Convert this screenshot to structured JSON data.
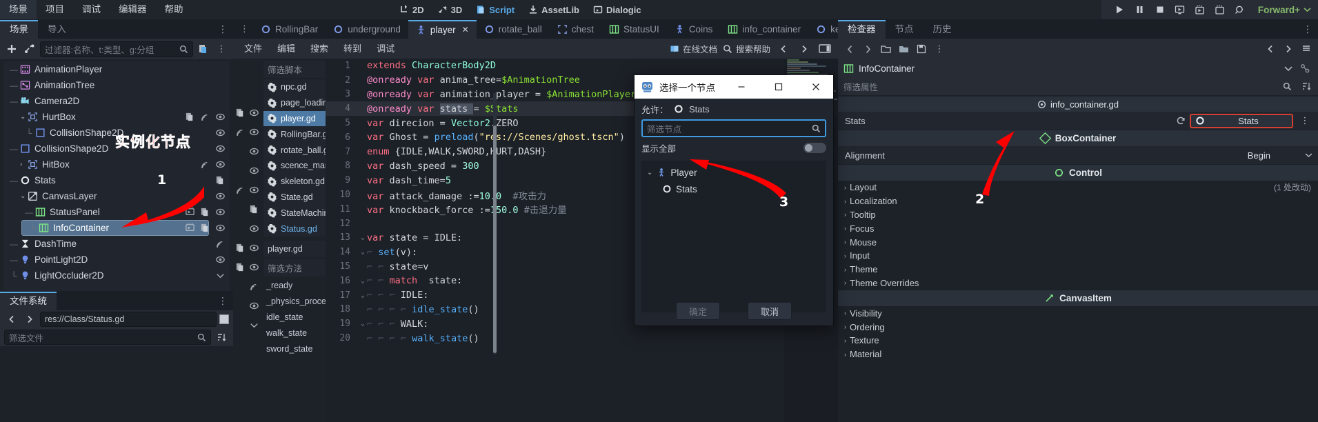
{
  "menu": {
    "items": [
      "场景",
      "项目",
      "调试",
      "编辑器",
      "帮助"
    ]
  },
  "modes": [
    {
      "label": "2D",
      "icon": "2d-icon",
      "active": false
    },
    {
      "label": "3D",
      "icon": "3d-icon",
      "active": false
    },
    {
      "label": "Script",
      "icon": "script-icon",
      "active": true
    },
    {
      "label": "AssetLib",
      "icon": "assetlib-icon",
      "active": false
    },
    {
      "label": "Dialogic",
      "icon": "dialogic-icon",
      "active": false
    }
  ],
  "playbar": {
    "buttons": [
      "play-icon",
      "pause-icon",
      "stop-icon",
      "play-scene-icon",
      "play-custom-icon",
      "movie-writer-icon",
      "remote-debug-icon"
    ],
    "renderer": "Forward+"
  },
  "left_dock": {
    "tabs": [
      {
        "label": "场景",
        "active": true
      },
      {
        "label": "导入",
        "active": false
      }
    ],
    "toolbar": {
      "add_icon": "plus-icon",
      "link_icon": "instance-child-scene-icon",
      "filter_placeholder": "过滤器:名称、t:类型、g:分组",
      "search_icon": "search-icon",
      "script_icon": "attach-script-icon",
      "more_icon": "vertical-dots-icon"
    },
    "tree": [
      {
        "label": "AnimationPlayer",
        "depth": 1,
        "icon": "animationplayer-icon",
        "caret": "",
        "branch": "—",
        "right": [],
        "selected": false
      },
      {
        "label": "AnimationTree",
        "depth": 1,
        "icon": "animationtree-icon",
        "caret": "",
        "branch": "—",
        "right": [],
        "selected": false
      },
      {
        "label": "Camera2D",
        "depth": 1,
        "icon": "camera2d-icon",
        "caret": "",
        "branch": "—",
        "right": [],
        "selected": false
      },
      {
        "label": "HurtBox",
        "depth": 1,
        "icon": "area2d-icon",
        "caret": "⌄",
        "branch": "",
        "right": [
          "script-icon",
          "signal-icon",
          "eye-icon"
        ],
        "selected": false
      },
      {
        "label": "CollisionShape2D",
        "depth": 2,
        "icon": "collisionshape2d-icon",
        "caret": "",
        "branch": "└",
        "right": [
          "eye-icon"
        ],
        "selected": false
      },
      {
        "label": "CollisionShape2D",
        "depth": 1,
        "icon": "collisionshape2d-icon",
        "caret": "",
        "branch": "—",
        "right": [
          "eye-icon"
        ],
        "selected": false
      },
      {
        "label": "HitBox",
        "depth": 1,
        "icon": "area2d-icon",
        "caret": "›",
        "branch": "",
        "right": [
          "signal-icon",
          "eye-icon"
        ],
        "selected": false
      },
      {
        "label": "Stats",
        "depth": 1,
        "icon": "node-icon",
        "caret": "",
        "branch": "—",
        "right": [
          "script-icon"
        ],
        "selected": false
      },
      {
        "label": "CanvasLayer",
        "depth": 1,
        "icon": "canvaslayer-icon",
        "caret": "⌄",
        "branch": "",
        "right": [
          "eye-icon"
        ],
        "selected": false
      },
      {
        "label": "StatusPanel",
        "depth": 2,
        "icon": "container-icon",
        "caret": "",
        "branch": "—",
        "right": [
          "scene-instance-icon",
          "script-icon",
          "eye-icon"
        ],
        "selected": false
      },
      {
        "label": "InfoContainer",
        "depth": 2,
        "icon": "container-icon",
        "caret": "",
        "branch": "└",
        "right": [
          "scene-instance-icon",
          "script-icon",
          "eye-icon"
        ],
        "selected": true
      },
      {
        "label": "DashTime",
        "depth": 1,
        "icon": "timer-icon",
        "caret": "",
        "branch": "—",
        "right": [
          "signal-icon"
        ],
        "selected": false
      },
      {
        "label": "PointLight2D",
        "depth": 1,
        "icon": "pointlight2d-icon",
        "caret": "",
        "branch": "—",
        "right": [
          "eye-icon"
        ],
        "selected": false
      },
      {
        "label": "LightOccluder2D",
        "depth": 1,
        "icon": "lightoccluder2d-icon",
        "caret": "",
        "branch": "└",
        "right": [
          "collapse-icon"
        ],
        "selected": false
      }
    ]
  },
  "filesystem": {
    "tabs": [
      {
        "label": "文件系统",
        "active": true
      }
    ],
    "back_icon": "chevron-left-icon",
    "forward_icon": "chevron-right-icon",
    "path": "res://Class/Status.gd",
    "filter_placeholder": "筛选文件",
    "search_icon": "search-icon",
    "sort_icon": "sort-icon",
    "more_icon": "vertical-dots-icon"
  },
  "script_editor": {
    "tabs": [
      {
        "label": "RollingBar",
        "icon": "node2d-icon",
        "active": false,
        "closable": false
      },
      {
        "label": "underground",
        "icon": "node2d-icon",
        "active": false,
        "closable": false
      },
      {
        "label": "player",
        "icon": "characterbody2d-icon",
        "active": true,
        "closable": true
      },
      {
        "label": "rotate_ball",
        "icon": "node2d-icon",
        "active": false,
        "closable": false
      },
      {
        "label": "chest",
        "icon": "sprite-icon",
        "active": false,
        "closable": false
      },
      {
        "label": "StatusUI",
        "icon": "container-icon",
        "active": false,
        "closable": false
      },
      {
        "label": "Coins",
        "icon": "characterbody2d-icon",
        "active": false,
        "closable": false
      },
      {
        "label": "info_container",
        "icon": "container-icon",
        "active": false,
        "closable": false
      },
      {
        "label": "key_door",
        "icon": "node2d-icon",
        "active": false,
        "closable": false
      }
    ],
    "tabbar_right_icons": [
      "previous-tab-icon",
      "next-tab-icon",
      "add-tab-icon",
      "fullscreen-icon"
    ],
    "menus": [
      "文件",
      "编辑",
      "搜索",
      "转到",
      "调试"
    ],
    "help_buttons": [
      {
        "label": "在线文档",
        "icon": "book-icon"
      },
      {
        "label": "搜索帮助",
        "icon": "search-icon"
      }
    ],
    "nav_icons": [
      "chevron-left-icon",
      "chevron-right-icon",
      "panel-toggle-icon"
    ],
    "script_filter_placeholder": "筛选脚本",
    "script_list": [
      {
        "label": "npc.gd",
        "state": "normal"
      },
      {
        "label": "page_loading....",
        "state": "normal"
      },
      {
        "label": "player.gd",
        "state": "selected"
      },
      {
        "label": "RollingBar.gd",
        "state": "normal"
      },
      {
        "label": "rotate_ball.gd",
        "state": "normal"
      },
      {
        "label": "scence_manag...",
        "state": "normal"
      },
      {
        "label": "skeleton.gd",
        "state": "normal"
      },
      {
        "label": "State.gd",
        "state": "normal"
      },
      {
        "label": "StateMachine....",
        "state": "normal"
      },
      {
        "label": "Status.gd",
        "state": "highlight"
      }
    ],
    "current_script": "player.gd",
    "sort_icon": "sort-icon",
    "member_filter_placeholder": "筛选方法",
    "members": [
      "_ready",
      "_physics_process",
      "idle_state",
      "walk_state",
      "sword_state"
    ],
    "code_lines": [
      {
        "n": 1,
        "fold": "",
        "tokens": [
          {
            "t": "extends ",
            "c": "kw"
          },
          {
            "t": "CharacterBody2D",
            "c": "type"
          }
        ]
      },
      {
        "n": 2,
        "fold": "",
        "tokens": [
          {
            "t": "@onready ",
            "c": "kw2"
          },
          {
            "t": "var ",
            "c": "kw"
          },
          {
            "t": "anima_tree",
            "c": "sym"
          },
          {
            "t": "=",
            "c": "sym"
          },
          {
            "t": "$AnimationTree",
            "c": "node"
          }
        ]
      },
      {
        "n": 3,
        "fold": "",
        "tokens": [
          {
            "t": "@onready ",
            "c": "kw2"
          },
          {
            "t": "var ",
            "c": "kw"
          },
          {
            "t": "animation_player ",
            "c": "sym"
          },
          {
            "t": "= ",
            "c": "sym"
          },
          {
            "t": "$AnimationPlayer",
            "c": "node"
          }
        ]
      },
      {
        "n": 4,
        "fold": "",
        "current": true,
        "tokens": [
          {
            "t": "@onready ",
            "c": "kw2"
          },
          {
            "t": "var ",
            "c": "kw"
          },
          {
            "t": "stats ",
            "c": "sel"
          },
          {
            "t": "= ",
            "c": "sym"
          },
          {
            "t": "$Stats",
            "c": "node"
          }
        ]
      },
      {
        "n": 5,
        "fold": "",
        "tokens": [
          {
            "t": "var ",
            "c": "kw"
          },
          {
            "t": "direcion ",
            "c": "sym"
          },
          {
            "t": "= ",
            "c": "sym"
          },
          {
            "t": "Vector2",
            "c": "type"
          },
          {
            "t": ".ZERO",
            "c": "sym"
          }
        ]
      },
      {
        "n": 6,
        "fold": "",
        "tokens": [
          {
            "t": "var ",
            "c": "kw"
          },
          {
            "t": "Ghost ",
            "c": "sym"
          },
          {
            "t": "= ",
            "c": "sym"
          },
          {
            "t": "preload",
            "c": "fn"
          },
          {
            "t": "(",
            "c": "sym"
          },
          {
            "t": "\"res://Scenes/ghost.tscn\"",
            "c": "str"
          },
          {
            "t": ")",
            "c": "sym"
          }
        ]
      },
      {
        "n": 7,
        "fold": "",
        "tokens": [
          {
            "t": "enum ",
            "c": "kw"
          },
          {
            "t": "{IDLE,WALK,SWORD,HURT,DASH}",
            "c": "sym"
          }
        ]
      },
      {
        "n": 8,
        "fold": "",
        "tokens": [
          {
            "t": "var ",
            "c": "kw"
          },
          {
            "t": "dash_speed ",
            "c": "sym"
          },
          {
            "t": "= ",
            "c": "sym"
          },
          {
            "t": "300",
            "c": "num"
          }
        ]
      },
      {
        "n": 9,
        "fold": "",
        "tokens": [
          {
            "t": "var ",
            "c": "kw"
          },
          {
            "t": "dash_time",
            "c": "sym"
          },
          {
            "t": "=",
            "c": "sym"
          },
          {
            "t": "5",
            "c": "num"
          }
        ]
      },
      {
        "n": 10,
        "fold": "",
        "tokens": [
          {
            "t": "var ",
            "c": "kw"
          },
          {
            "t": "attack_damage ",
            "c": "sym"
          },
          {
            "t": ":=",
            "c": "sym"
          },
          {
            "t": "10.0",
            "c": "num"
          },
          {
            "t": "  #攻击力",
            "c": "cmt"
          }
        ]
      },
      {
        "n": 11,
        "fold": "",
        "tokens": [
          {
            "t": "var ",
            "c": "kw"
          },
          {
            "t": "knockback_force ",
            "c": "sym"
          },
          {
            "t": ":=",
            "c": "sym"
          },
          {
            "t": "150.0",
            "c": "num"
          },
          {
            "t": " #击退力量",
            "c": "cmt"
          }
        ]
      },
      {
        "n": 12,
        "fold": "",
        "tokens": []
      },
      {
        "n": 13,
        "fold": "⌄",
        "tokens": [
          {
            "t": "var ",
            "c": "kw"
          },
          {
            "t": "state ",
            "c": "sym"
          },
          {
            "t": "= ",
            "c": "sym"
          },
          {
            "t": "IDLE",
            "c": "sym"
          },
          {
            "t": ":",
            "c": "sym"
          }
        ]
      },
      {
        "n": 14,
        "fold": "⌄",
        "indent": 1,
        "tokens": [
          {
            "t": "set",
            "c": "fn"
          },
          {
            "t": "(v):",
            "c": "sym"
          }
        ]
      },
      {
        "n": 15,
        "fold": "",
        "indent": 2,
        "tokens": [
          {
            "t": "state=v",
            "c": "sym"
          }
        ]
      },
      {
        "n": 16,
        "fold": "⌄",
        "indent": 2,
        "tokens": [
          {
            "t": "match ",
            "c": "kw"
          },
          {
            "t": " state:",
            "c": "sym"
          }
        ]
      },
      {
        "n": 17,
        "fold": "⌄",
        "indent": 3,
        "tokens": [
          {
            "t": "IDLE:",
            "c": "sym"
          }
        ]
      },
      {
        "n": 18,
        "fold": "",
        "indent": 4,
        "tokens": [
          {
            "t": "idle_state",
            "c": "fn"
          },
          {
            "t": "()",
            "c": "sym"
          }
        ]
      },
      {
        "n": 19,
        "fold": "⌄",
        "indent": 3,
        "tokens": [
          {
            "t": "WALK:",
            "c": "sym"
          }
        ]
      },
      {
        "n": 20,
        "fold": "",
        "indent": 4,
        "tokens": [
          {
            "t": "walk_state",
            "c": "fn"
          },
          {
            "t": "()",
            "c": "sym"
          }
        ]
      }
    ]
  },
  "inspector": {
    "tabs": [
      {
        "label": "检查器",
        "active": true
      },
      {
        "label": "节点",
        "active": false
      },
      {
        "label": "历史",
        "active": false
      }
    ],
    "toolbar_icons": [
      "back-icon",
      "forward-icon",
      "open-icon",
      "folder-icon",
      "save-icon",
      "vertical-dots-icon"
    ],
    "toolbar_right_icons": [
      "prev-icon",
      "next-icon",
      "history-icon"
    ],
    "object_name": "InfoContainer",
    "object_icon": "container-icon",
    "object_dropdown_icon": "chevron-down-icon",
    "object_right_icon": "node-link-icon",
    "filter_placeholder": "筛选属性",
    "filter_search_icon": "search-icon",
    "filter_tools_icon": "sort-icon",
    "script_row": {
      "label": "info_container.gd",
      "icon": "script-file-icon"
    },
    "stats_prop": {
      "label": "Stats",
      "revert_icon": "revert-icon",
      "value": "Stats",
      "value_icon": "node-circle-icon",
      "more_icon": "vertical-dots-icon"
    },
    "categories": [
      {
        "type": "category",
        "label": "BoxContainer",
        "icon": "boxcontainer-icon"
      },
      {
        "type": "prop",
        "label": "Alignment",
        "value": "Begin"
      },
      {
        "type": "category",
        "label": "Control",
        "icon": "control-icon"
      },
      {
        "type": "group",
        "label": "Layout",
        "badge": "(1 处改动)"
      },
      {
        "type": "group",
        "label": "Localization",
        "badge": ""
      },
      {
        "type": "group",
        "label": "Tooltip",
        "badge": ""
      },
      {
        "type": "group",
        "label": "Focus",
        "badge": ""
      },
      {
        "type": "group",
        "label": "Mouse",
        "badge": ""
      },
      {
        "type": "group",
        "label": "Input",
        "badge": ""
      },
      {
        "type": "group",
        "label": "Theme",
        "badge": ""
      },
      {
        "type": "group",
        "label": "Theme Overrides",
        "badge": ""
      },
      {
        "type": "category",
        "label": "CanvasItem",
        "icon": "canvasitem-icon"
      },
      {
        "type": "group",
        "label": "Visibility",
        "badge": ""
      },
      {
        "type": "group",
        "label": "Ordering",
        "badge": ""
      },
      {
        "type": "group",
        "label": "Texture",
        "badge": ""
      },
      {
        "type": "group",
        "label": "Material",
        "badge": ""
      }
    ]
  },
  "dialog": {
    "title": "选择一个节点",
    "icon": "godot-icon",
    "minimize": "–",
    "maximize": "□",
    "close": "✕",
    "allow_label": "允许：",
    "allow_value": "Stats",
    "allow_icon": "node-circle-icon",
    "search_placeholder": "筛选节点",
    "search_icon": "search-icon",
    "show_all_label": "显示全部",
    "tree": [
      {
        "label": "Player",
        "depth": 0,
        "caret": "⌄",
        "icon": "characterbody2d-icon"
      },
      {
        "label": "Stats",
        "depth": 1,
        "caret": "",
        "icon": "node-circle-icon"
      }
    ],
    "ok_label": "确定",
    "cancel_label": "取消"
  },
  "annotations": [
    {
      "id": "1",
      "text": "实例化节点",
      "number": "1"
    },
    {
      "id": "2",
      "number": "2"
    },
    {
      "id": "3",
      "number": "3"
    }
  ],
  "colors": {
    "accent": "#5aabe8",
    "selection": "#54728f",
    "annotation": "#ff1a1a",
    "renderer": "#87ba6b"
  }
}
